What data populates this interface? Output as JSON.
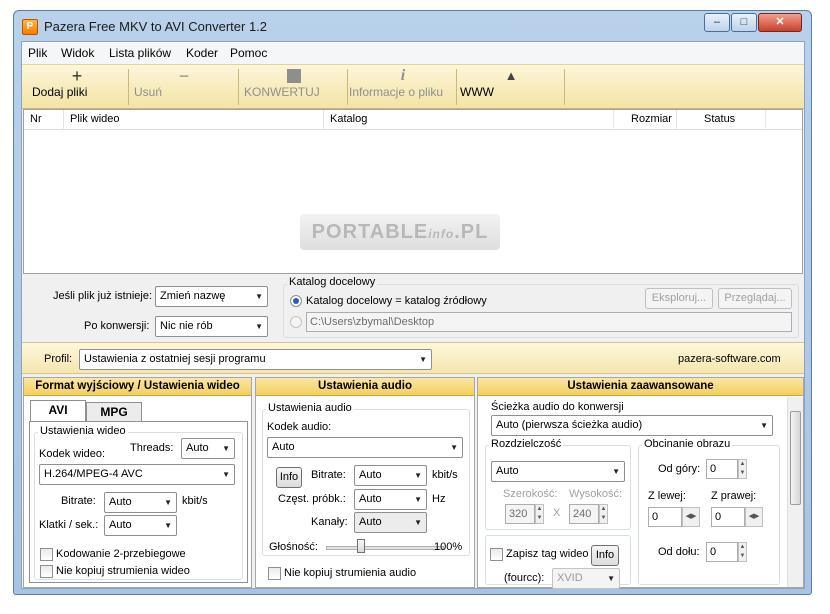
{
  "window": {
    "title": "Pazera Free MKV to AVI Converter 1.2",
    "icon": "app-icon"
  },
  "menu": [
    "Plik",
    "Widok",
    "Lista plików",
    "Koder",
    "Pomoc"
  ],
  "toolbar": {
    "add": {
      "label": "Dodaj pliki",
      "icon": "plus-icon"
    },
    "remove": {
      "label": "Usuń",
      "icon": "minus-icon"
    },
    "convert": {
      "label": "KONWERTUJ",
      "icon": "stop-square-icon"
    },
    "info": {
      "label": "Informacje o pliku",
      "icon": "info-icon"
    },
    "www": {
      "label": "WWW",
      "icon": "home-icon"
    }
  },
  "filelist": {
    "columns": [
      "Nr",
      "Plik wideo",
      "Katalog",
      "Rozmiar",
      "Status"
    ],
    "rows": [],
    "watermark": {
      "main": "PORTABLE",
      "sub": "info",
      "suffix": ".PL"
    }
  },
  "options": {
    "if_exists_label": "Jeśli plik już istnieje:",
    "if_exists_value": "Zmień nazwę",
    "after_label": "Po konwersji:",
    "after_value": "Nic nie rób",
    "target_group": "Katalog docelowy",
    "radio_same": "Katalog docelowy = katalog źródłowy",
    "radio_custom_path": "C:\\Users\\zbymal\\Desktop",
    "explore_btn": "Eksploruj...",
    "browse_btn": "Przeglądaj..."
  },
  "profile": {
    "label": "Profil:",
    "value": "Ustawienia z ostatniej sesji programu",
    "site": "pazera-software.com"
  },
  "video": {
    "header": "Format wyjściowy / Ustawienia wideo",
    "tabs": [
      "AVI",
      "MPG"
    ],
    "group": "Ustawienia wideo",
    "codec_label": "Kodek wideo:",
    "threads_label": "Threads:",
    "threads_value": "Auto",
    "codec_value": "H.264/MPEG-4 AVC",
    "bitrate_label": "Bitrate:",
    "bitrate_value": "Auto",
    "bitrate_unit": "kbit/s",
    "fps_label": "Klatki / sek.:",
    "fps_value": "Auto",
    "twopass": "Kodowanie 2-przebiegowe",
    "nocopy": "Nie kopiuj strumienia wideo"
  },
  "audio": {
    "header": "Ustawienia audio",
    "group": "Ustawienia audio",
    "codec_label": "Kodek audio:",
    "codec_value": "Auto",
    "info_btn": "Info",
    "bitrate_label": "Bitrate:",
    "bitrate_value": "Auto",
    "bitrate_unit": "kbit/s",
    "freq_label": "Częst. próbk.:",
    "freq_value": "Auto",
    "freq_unit": "Hz",
    "channels_label": "Kanały:",
    "channels_value": "Auto",
    "volume_label": "Głośność:",
    "volume_value": "100%",
    "volume_level": 0.3,
    "nocopy": "Nie kopiuj strumienia audio"
  },
  "advanced": {
    "header": "Ustawienia zaawansowane",
    "audio_track_label": "Ścieżka audio do konwersji",
    "audio_track_value": "Auto (pierwsza ścieżka audio)",
    "resolution_group": "Rozdzielczość",
    "resolution_value": "Auto",
    "width_label": "Szerokość:",
    "height_label": "Wysokość:",
    "width_value": "320",
    "height_value": "240",
    "x_sep": "X",
    "crop_group": "Obcinanie obrazu",
    "top_label": "Od góry:",
    "top_value": "0",
    "left_label": "Z lewej:",
    "left_value": "0",
    "right_label": "Z prawej:",
    "right_value": "0",
    "bottom_label": "Od dołu:",
    "bottom_value": "0",
    "tag_label": "Zapisz tag wideo",
    "tag_info_btn": "Info",
    "fourcc_label": "(fourcc):",
    "fourcc_value": "XVID"
  }
}
